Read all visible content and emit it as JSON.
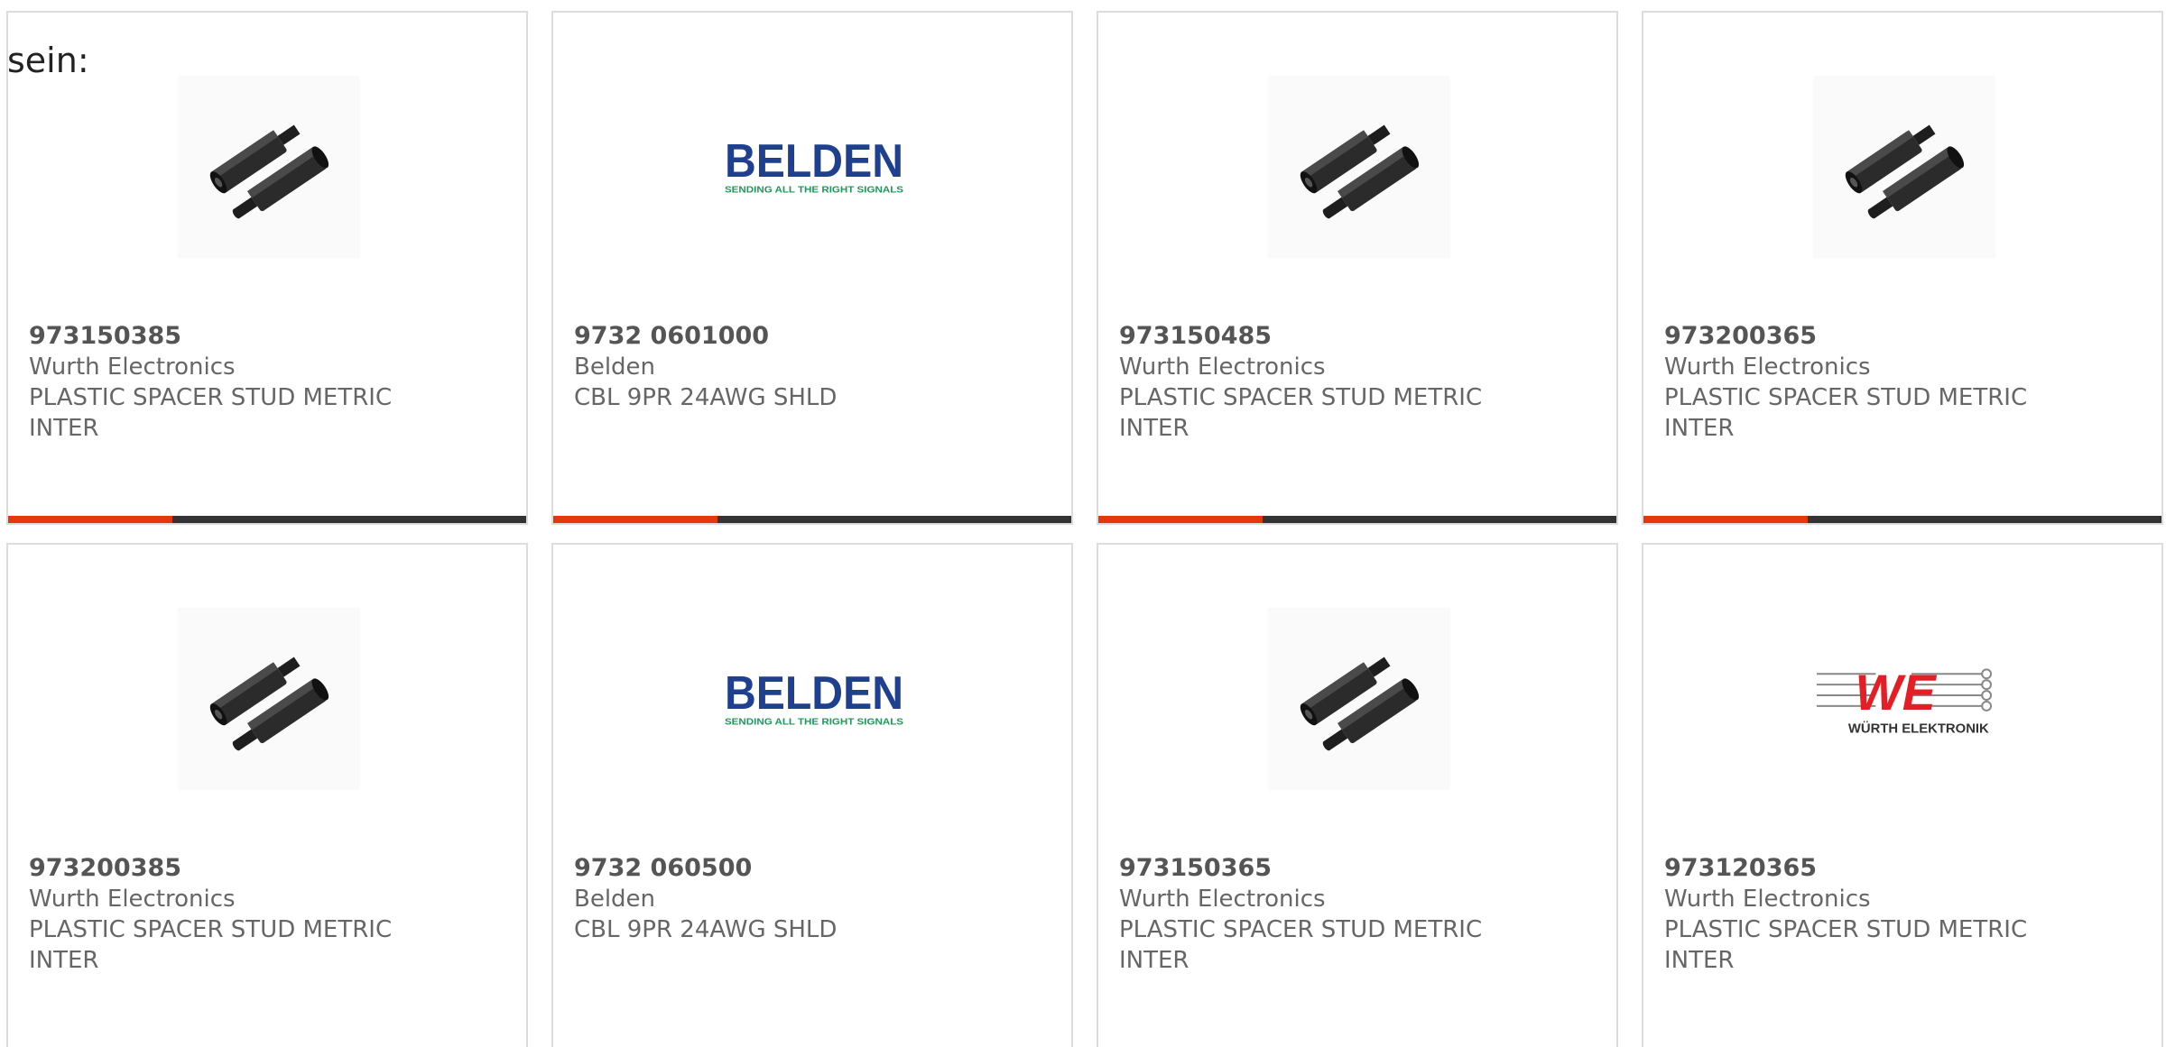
{
  "intro_text": "sein:",
  "products": [
    {
      "part_number": "973150385",
      "manufacturer": "Wurth Electronics",
      "description": "PLASTIC SPACER STUD METRIC INTER",
      "image": "spacer-stud-photo"
    },
    {
      "part_number": "9732 0601000",
      "manufacturer": "Belden",
      "description": "CBL 9PR 24AWG SHLD",
      "image": "belden-logo"
    },
    {
      "part_number": "973150485",
      "manufacturer": "Wurth Electronics",
      "description": "PLASTIC SPACER STUD METRIC INTER",
      "image": "spacer-stud-photo"
    },
    {
      "part_number": "973200365",
      "manufacturer": "Wurth Electronics",
      "description": "PLASTIC SPACER STUD METRIC INTER",
      "image": "spacer-stud-photo"
    },
    {
      "part_number": "973200385",
      "manufacturer": "Wurth Electronics",
      "description": "PLASTIC SPACER STUD METRIC INTER",
      "image": "spacer-stud-photo"
    },
    {
      "part_number": "9732 060500",
      "manufacturer": "Belden",
      "description": "CBL 9PR 24AWG SHLD",
      "image": "belden-logo"
    },
    {
      "part_number": "973150365",
      "manufacturer": "Wurth Electronics",
      "description": "PLASTIC SPACER STUD METRIC INTER",
      "image": "spacer-stud-photo"
    },
    {
      "part_number": "973120365",
      "manufacturer": "Wurth Electronics",
      "description": "PLASTIC SPACER STUD METRIC INTER",
      "image": "wurth-elektronik-logo"
    }
  ],
  "logos": {
    "belden": {
      "name": "BELDEN",
      "tagline": "SENDING ALL THE RIGHT SIGNALS",
      "color": "#1f3f8f",
      "tagline_color": "#1a9a5a"
    },
    "wurth": {
      "name": "WE",
      "tagline": "WÜRTH ELEKTRONIK",
      "color": "#e31e24"
    }
  },
  "colors": {
    "card_border": "#dcdcdc",
    "accent_bar": "#e4380c",
    "dark_bar": "#333333",
    "text": "#666666"
  }
}
